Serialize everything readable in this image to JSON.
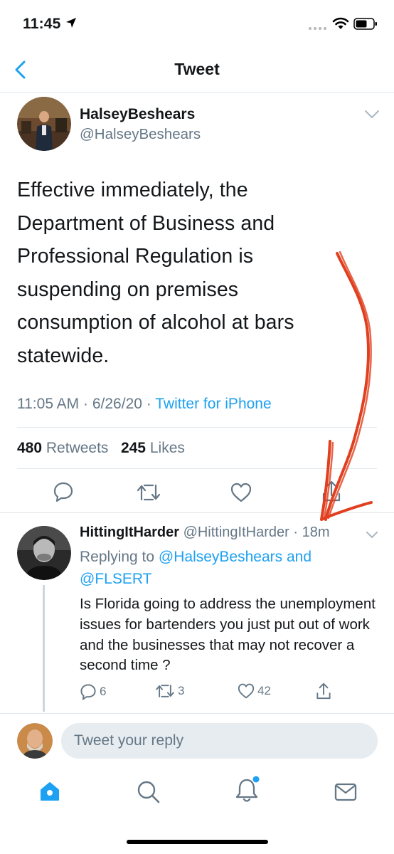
{
  "status_bar": {
    "time": "11:45",
    "icons": [
      "location-arrow-icon",
      "cell-signal-icon",
      "wifi-icon",
      "battery-icon"
    ]
  },
  "nav": {
    "title": "Tweet",
    "back_icon": "chevron-left-icon"
  },
  "main_tweet": {
    "author_name": "HalseyBeshears",
    "author_handle": "@HalseyBeshears",
    "text": "Effective immediately, the Department of Business and Professional Regulation is suspending on premises consumption of alcohol at bars statewide.",
    "time": "11:05 AM",
    "separator": "·",
    "date": "6/26/20",
    "source": "Twitter for iPhone",
    "retweets_count": "480",
    "retweets_label": "Retweets",
    "likes_count": "245",
    "likes_label": "Likes",
    "actions": [
      "reply-icon",
      "retweet-icon",
      "like-icon",
      "share-icon"
    ]
  },
  "reply": {
    "author_name": "HittingItHarder",
    "author_handle": "@HittingItHarder",
    "age": "· 18m",
    "replying_prefix": "Replying to",
    "replying_to": "@HalseyBeshears and @FLSERT",
    "text": "Is Florida going to address the unemployment issues for bartenders you just put out of work and the businesses that may not recover a second time ?",
    "reply_count": "6",
    "retweet_count": "3",
    "like_count": "42"
  },
  "composer": {
    "placeholder": "Tweet your reply"
  },
  "tab_bar": {
    "items": [
      "home-icon",
      "search-icon",
      "notifications-icon",
      "messages-icon"
    ],
    "accent": "#1da1f2",
    "notification_dot_color": "#1da1f2"
  },
  "annotation": {
    "arrow_color": "#e0401f"
  }
}
